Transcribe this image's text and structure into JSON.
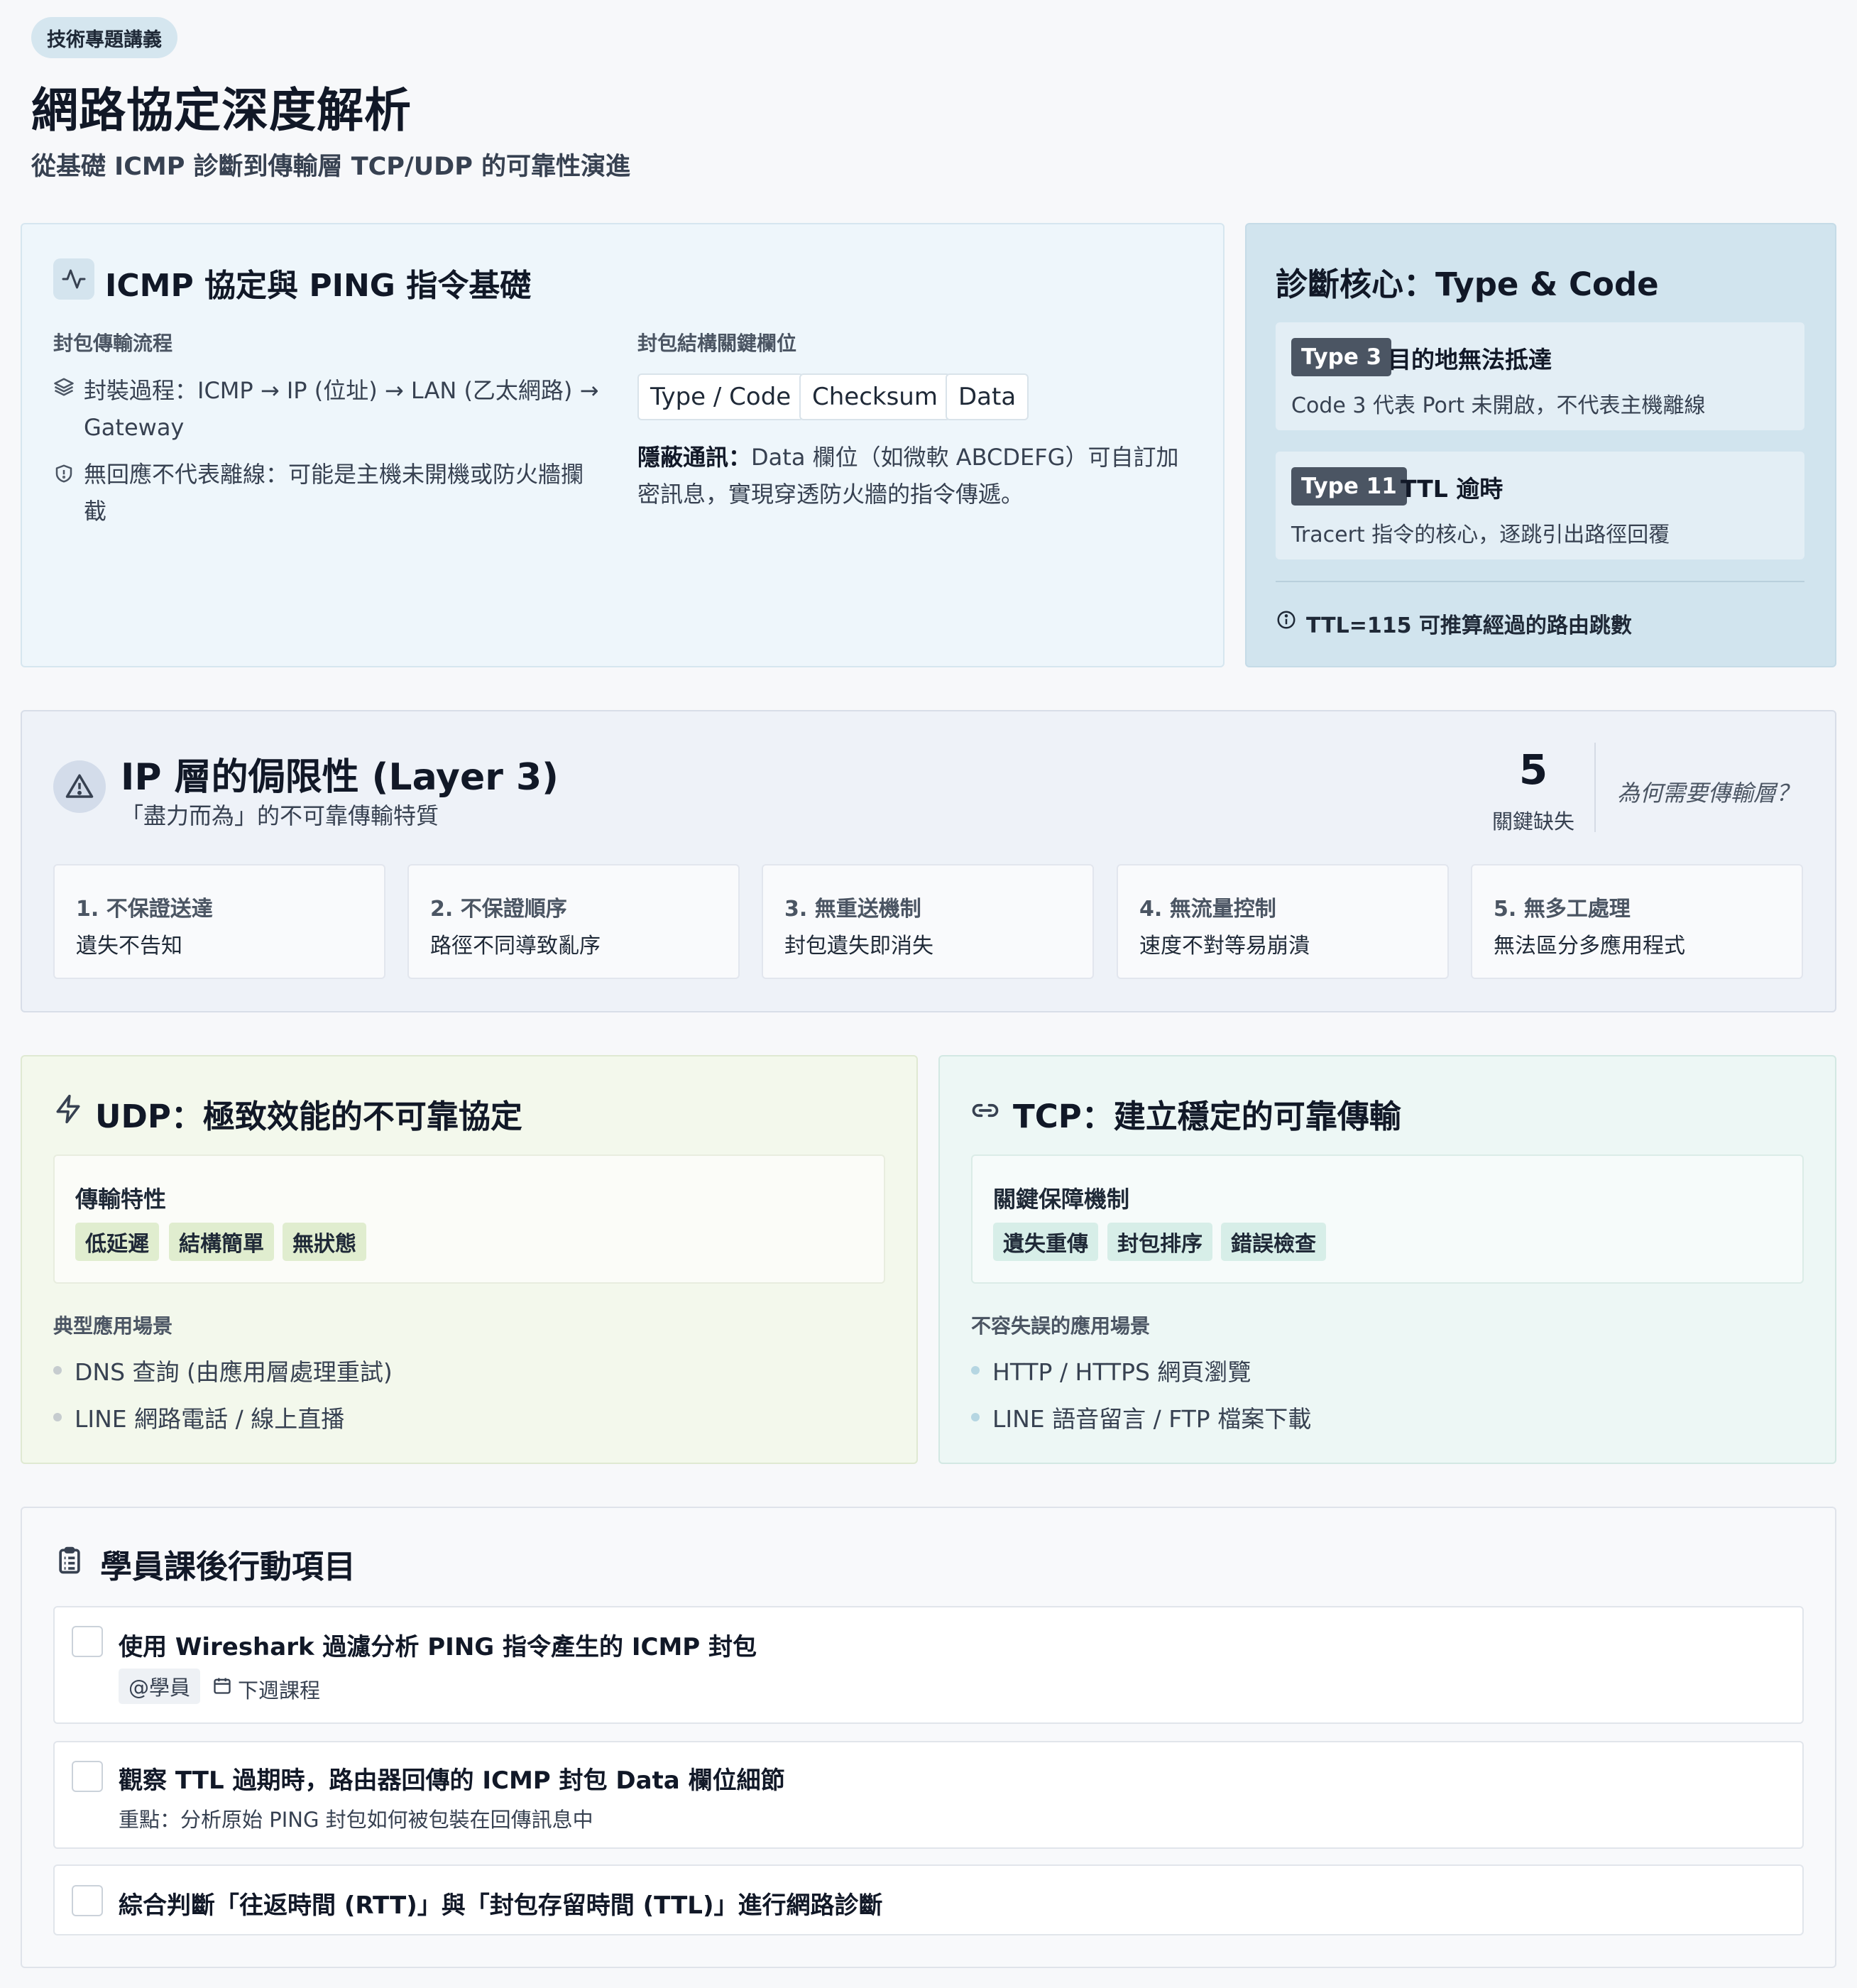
{
  "header": {
    "tag": "技術專題講義",
    "title": "網路協定深度解析",
    "subtitle": "從基礎 ICMP 診斷到傳輸層 TCP/UDP 的可靠性演進"
  },
  "icmp": {
    "title": "ICMP 協定與 PING 指令基礎",
    "flow_label": "封包傳輸流程",
    "flow_items": [
      {
        "line1": "封裝過程：ICMP → IP (位址) → LAN (乙太網路) →",
        "line2": "Gateway"
      },
      {
        "line1": "無回應不代表離線：可能是主機未開機或防火牆攔",
        "line2": "截"
      }
    ],
    "fields_label": "封包結構關鍵欄位",
    "fields": [
      "Type / Code",
      "Checksum",
      "Data"
    ],
    "covert_label": "隱蔽通訊：",
    "covert_line1": "Data 欄位（如微軟 ABCDEFG）可自訂加",
    "covert_line2": "密訊息，實現穿透防火牆的指令傳遞。"
  },
  "diagnosis": {
    "title": "診斷核心：Type & Code",
    "items": [
      {
        "badge": "Type 3",
        "title": "目的地無法抵達",
        "desc": "Code 3 代表 Port 未開啟，不代表主機離線"
      },
      {
        "badge": "Type 11",
        "title": "TTL 逾時",
        "desc": "Tracert 指令的核心，逐跳引出路徑回覆"
      }
    ],
    "note": "TTL=115 可推算經過的路由跳數"
  },
  "ip_layer": {
    "title": "IP 層的侷限性 (Layer 3)",
    "subtitle": "「盡力而為」的不可靠傳輸特質",
    "count": "5",
    "count_label": "關鍵缺失",
    "question": "為何需要傳輸層？",
    "limits": [
      {
        "title": "1. 不保證送達",
        "desc": "遺失不告知"
      },
      {
        "title": "2. 不保證順序",
        "desc": "路徑不同導致亂序"
      },
      {
        "title": "3. 無重送機制",
        "desc": "封包遺失即消失"
      },
      {
        "title": "4. 無流量控制",
        "desc": "速度不對等易崩潰"
      },
      {
        "title": "5. 無多工處理",
        "desc": "無法區分多應用程式"
      }
    ]
  },
  "udp": {
    "title": "UDP：極致效能的不可靠協定",
    "panel_label": "傳輸特性",
    "chips": [
      "低延遲",
      "結構簡單",
      "無狀態"
    ],
    "use_label": "典型應用場景",
    "uses": [
      "DNS 查詢 (由應用層處理重試)",
      "LINE 網路電話 / 線上直播"
    ]
  },
  "tcp": {
    "title": "TCP：建立穩定的可靠傳輸",
    "panel_label": "關鍵保障機制",
    "chips": [
      "遺失重傳",
      "封包排序",
      "錯誤檢查"
    ],
    "use_label": "不容失誤的應用場景",
    "uses": [
      "HTTP / HTTPS 網頁瀏覽",
      "LINE 語音留言 / FTP 檔案下載"
    ]
  },
  "actions": {
    "title": "學員課後行動項目",
    "tasks": [
      {
        "text": "使用 Wireshark 過濾分析 PING 指令產生的 ICMP 封包",
        "assignee": "@學員",
        "due": "下週課程"
      },
      {
        "text": "觀察 TTL 過期時，路由器回傳的 ICMP 封包 Data 欄位細節",
        "note": "重點：分析原始 PING 封包如何被包裝在回傳訊息中"
      },
      {
        "text": "綜合判斷「往返時間 (RTT)」與「封包存留時間 (TTL)」進行網路診斷"
      }
    ]
  },
  "colors": {
    "udp_accent": "#e0edcf",
    "tcp_accent": "#d7eee8",
    "badge": "#4b5563"
  }
}
